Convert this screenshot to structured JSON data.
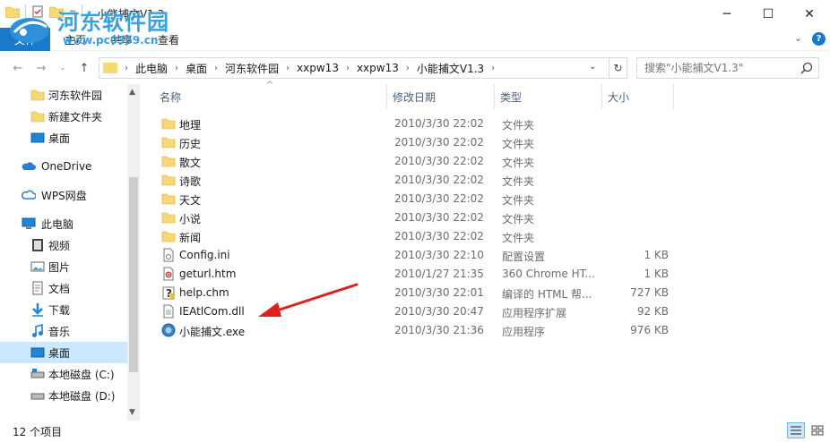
{
  "window": {
    "title": "小能捕文V1.3",
    "controls": {
      "minimize": "─",
      "maximize": "☐",
      "close": "✕"
    }
  },
  "ribbon": {
    "tabs": [
      "文件",
      "主页",
      "共享",
      "查看"
    ],
    "help": "?"
  },
  "watermark": {
    "title": "河东软件园",
    "url": "www.pc0359.cn"
  },
  "address": {
    "crumbs": [
      "此电脑",
      "桌面",
      "河东软件园",
      "xxpw13",
      "xxpw13",
      "小能捕文V1.3"
    ],
    "search_placeholder": "搜索\"小能捕文V1.3\""
  },
  "sidebar": {
    "items": [
      {
        "label": "河东软件园",
        "icon": "folder-icon"
      },
      {
        "label": "新建文件夹",
        "icon": "folder-icon"
      },
      {
        "label": "桌面",
        "icon": "desktop-icon"
      },
      {
        "label": "OneDrive",
        "icon": "cloud-icon"
      },
      {
        "label": "WPS网盘",
        "icon": "cloud-wps-icon"
      },
      {
        "label": "此电脑",
        "icon": "computer-icon"
      },
      {
        "label": "视频",
        "icon": "video-icon"
      },
      {
        "label": "图片",
        "icon": "picture-icon"
      },
      {
        "label": "文档",
        "icon": "document-icon"
      },
      {
        "label": "下载",
        "icon": "download-icon"
      },
      {
        "label": "音乐",
        "icon": "music-icon"
      },
      {
        "label": "桌面",
        "icon": "desktop-icon"
      },
      {
        "label": "本地磁盘 (C:)",
        "icon": "drive-icon"
      },
      {
        "label": "本地磁盘 (D:)",
        "icon": "drive-icon"
      }
    ]
  },
  "columns": {
    "name": "名称",
    "date": "修改日期",
    "type": "类型",
    "size": "大小"
  },
  "files": [
    {
      "name": "地理",
      "date": "2010/3/30 22:02",
      "type": "文件夹",
      "size": "",
      "icon": "folder-icon"
    },
    {
      "name": "历史",
      "date": "2010/3/30 22:02",
      "type": "文件夹",
      "size": "",
      "icon": "folder-icon"
    },
    {
      "name": "散文",
      "date": "2010/3/30 22:02",
      "type": "文件夹",
      "size": "",
      "icon": "folder-icon"
    },
    {
      "name": "诗歌",
      "date": "2010/3/30 22:02",
      "type": "文件夹",
      "size": "",
      "icon": "folder-icon"
    },
    {
      "name": "天文",
      "date": "2010/3/30 22:02",
      "type": "文件夹",
      "size": "",
      "icon": "folder-icon"
    },
    {
      "name": "小说",
      "date": "2010/3/30 22:02",
      "type": "文件夹",
      "size": "",
      "icon": "folder-icon"
    },
    {
      "name": "新闻",
      "date": "2010/3/30 22:02",
      "type": "文件夹",
      "size": "",
      "icon": "folder-icon"
    },
    {
      "name": "Config.ini",
      "date": "2010/3/30 22:10",
      "type": "配置设置",
      "size": "1 KB",
      "icon": "config-file-icon"
    },
    {
      "name": "geturl.htm",
      "date": "2010/1/27 21:35",
      "type": "360 Chrome HT...",
      "size": "1 KB",
      "icon": "chrome-file-icon"
    },
    {
      "name": "help.chm",
      "date": "2010/3/30 22:01",
      "type": "编译的 HTML 帮...",
      "size": "727 KB",
      "icon": "help-file-icon"
    },
    {
      "name": "IEAtlCom.dll",
      "date": "2010/3/30 20:47",
      "type": "应用程序扩展",
      "size": "92 KB",
      "icon": "dll-file-icon"
    },
    {
      "name": "小能捕文.exe",
      "date": "2010/3/30 21:36",
      "type": "应用程序",
      "size": "976 KB",
      "icon": "exe-file-icon"
    }
  ],
  "status": {
    "count": "12 个项目"
  },
  "colors": {
    "accent": "#1979ca",
    "selected": "#cce8ff",
    "folder": "#f8d775",
    "arrow": "#e02020"
  }
}
